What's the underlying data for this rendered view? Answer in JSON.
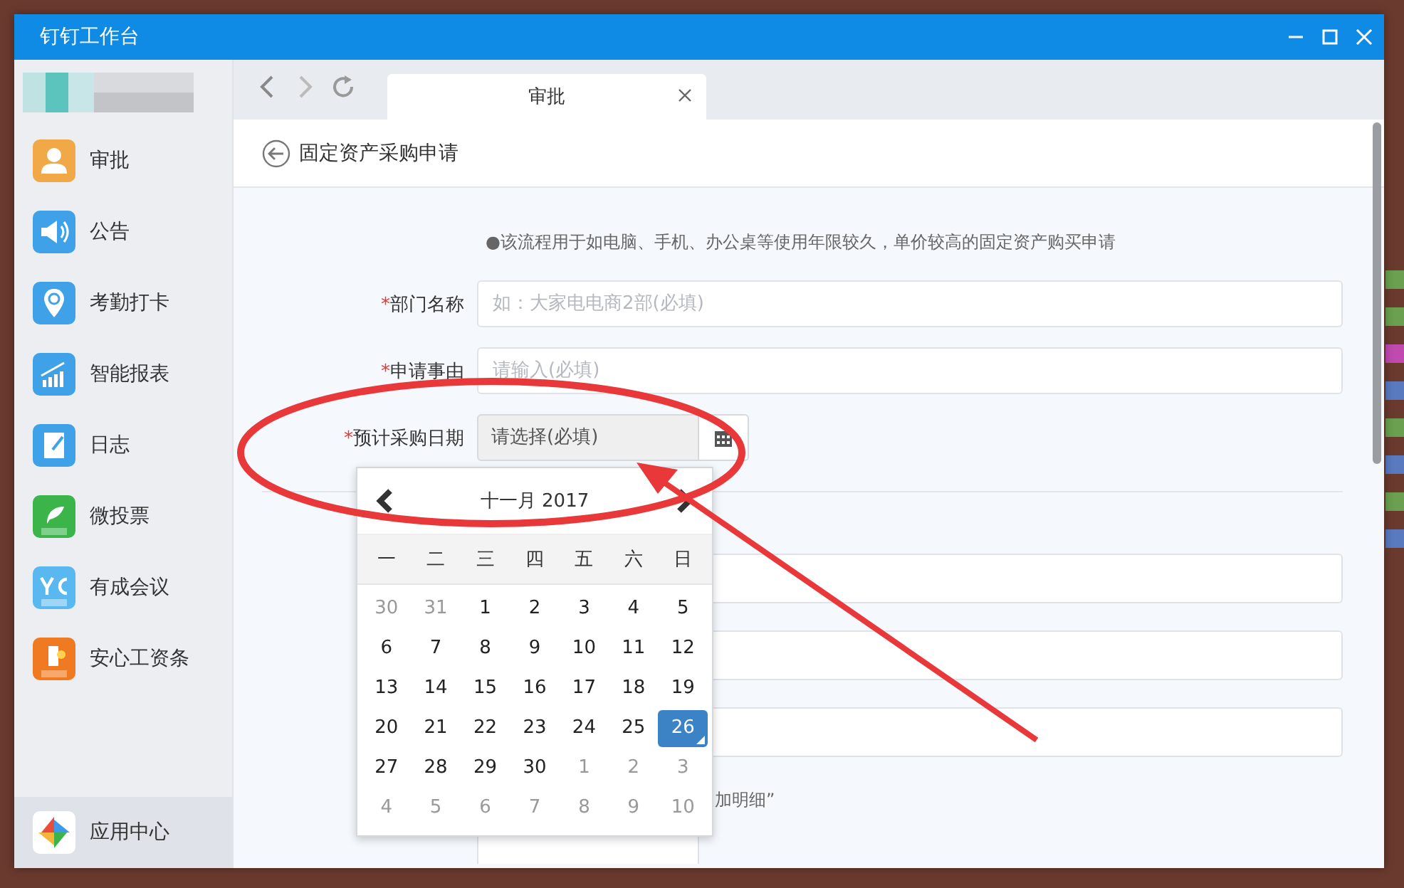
{
  "window": {
    "title": "钉钉工作台"
  },
  "sidebar": {
    "items": [
      {
        "label": "审批",
        "kind": "person",
        "color": "#f0a946",
        "selected": false
      },
      {
        "label": "公告",
        "kind": "speaker",
        "color": "#3fa2e9",
        "selected": false
      },
      {
        "label": "考勤打卡",
        "kind": "pin",
        "color": "#3fa2e9",
        "selected": false
      },
      {
        "label": "智能报表",
        "kind": "chart",
        "color": "#3fa2e9",
        "selected": false
      },
      {
        "label": "日志",
        "kind": "note",
        "color": "#3fa2e9",
        "selected": false
      },
      {
        "label": "微投票",
        "kind": "leaf",
        "color": "#3bb54a",
        "selected": false
      },
      {
        "label": "有成会议",
        "kind": "letters",
        "color": "#5ab8f0",
        "selected": false
      },
      {
        "label": "安心工资条",
        "kind": "bill",
        "color": "#f07a22",
        "selected": false
      }
    ],
    "footer": {
      "label": "应用中心",
      "selected": true
    }
  },
  "tabs": [
    {
      "label": "审批",
      "selected": true
    }
  ],
  "page": {
    "title": "固定资产采购申请"
  },
  "form": {
    "note": "●该流程用于如电脑、手机、办公桌等使用年限较久，单价较高的固定资产购买申请",
    "fields": [
      {
        "required_mark": "*",
        "label": "部门名称",
        "kind": "text",
        "placeholder": "如：大家电电商2部(必填)"
      },
      {
        "required_mark": "*",
        "label": "申请事由",
        "kind": "text",
        "placeholder": "请输入(必填)"
      },
      {
        "required_mark": "*",
        "label": "预计采购日期",
        "kind": "date",
        "placeholder": "请选择(必填)"
      }
    ],
    "lower_fields": [
      {
        "kind": "text"
      },
      {
        "kind": "text"
      },
      {
        "kind": "text"
      }
    ],
    "hint": "加明细”"
  },
  "calendar": {
    "title": "十一月 2017",
    "weekdays": [
      "一",
      "二",
      "三",
      "四",
      "五",
      "六",
      "日"
    ],
    "days": [
      {
        "day": "30",
        "muted": true,
        "selected": false
      },
      {
        "day": "31",
        "muted": true,
        "selected": false
      },
      {
        "day": "1",
        "muted": false,
        "selected": false
      },
      {
        "day": "2",
        "muted": false,
        "selected": false
      },
      {
        "day": "3",
        "muted": false,
        "selected": false
      },
      {
        "day": "4",
        "muted": false,
        "selected": false
      },
      {
        "day": "5",
        "muted": false,
        "selected": false
      },
      {
        "day": "6",
        "muted": false,
        "selected": false
      },
      {
        "day": "7",
        "muted": false,
        "selected": false
      },
      {
        "day": "8",
        "muted": false,
        "selected": false
      },
      {
        "day": "9",
        "muted": false,
        "selected": false
      },
      {
        "day": "10",
        "muted": false,
        "selected": false
      },
      {
        "day": "11",
        "muted": false,
        "selected": false
      },
      {
        "day": "12",
        "muted": false,
        "selected": false
      },
      {
        "day": "13",
        "muted": false,
        "selected": false
      },
      {
        "day": "14",
        "muted": false,
        "selected": false
      },
      {
        "day": "15",
        "muted": false,
        "selected": false
      },
      {
        "day": "16",
        "muted": false,
        "selected": false
      },
      {
        "day": "17",
        "muted": false,
        "selected": false
      },
      {
        "day": "18",
        "muted": false,
        "selected": false
      },
      {
        "day": "19",
        "muted": false,
        "selected": false
      },
      {
        "day": "20",
        "muted": false,
        "selected": false
      },
      {
        "day": "21",
        "muted": false,
        "selected": false
      },
      {
        "day": "22",
        "muted": false,
        "selected": false
      },
      {
        "day": "23",
        "muted": false,
        "selected": false
      },
      {
        "day": "24",
        "muted": false,
        "selected": false
      },
      {
        "day": "25",
        "muted": false,
        "selected": false
      },
      {
        "day": "26",
        "muted": false,
        "selected": true
      },
      {
        "day": "27",
        "muted": false,
        "selected": false
      },
      {
        "day": "28",
        "muted": false,
        "selected": false
      },
      {
        "day": "29",
        "muted": false,
        "selected": false
      },
      {
        "day": "30",
        "muted": false,
        "selected": false
      },
      {
        "day": "1",
        "muted": true,
        "selected": false
      },
      {
        "day": "2",
        "muted": true,
        "selected": false
      },
      {
        "day": "3",
        "muted": true,
        "selected": false
      },
      {
        "day": "4",
        "muted": true,
        "selected": false
      },
      {
        "day": "5",
        "muted": true,
        "selected": false
      },
      {
        "day": "6",
        "muted": true,
        "selected": false
      },
      {
        "day": "7",
        "muted": true,
        "selected": false
      },
      {
        "day": "8",
        "muted": true,
        "selected": false
      },
      {
        "day": "9",
        "muted": true,
        "selected": false
      },
      {
        "day": "10",
        "muted": true,
        "selected": false
      }
    ]
  }
}
